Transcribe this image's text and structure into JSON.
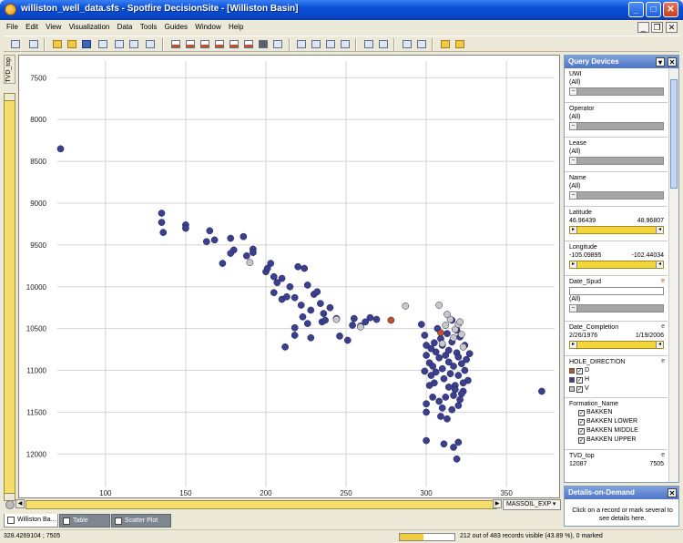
{
  "window": {
    "title": "williston_well_data.sfs - Spotfire DecisionSite - [Williston Basin]",
    "minimize": "_",
    "maximize": "□",
    "close": "✕"
  },
  "menu": [
    "File",
    "Edit",
    "View",
    "Visualization",
    "Data",
    "Tools",
    "Guides",
    "Window",
    "Help"
  ],
  "mdi": {
    "minimize": "_",
    "restore": "❐",
    "close": "✕"
  },
  "left_tab": {
    "label": "TVD_top"
  },
  "x_axis_column": "MASSOIL_EXP",
  "doc_tabs": [
    {
      "label": "Williston Ba..."
    },
    {
      "label": "Table"
    },
    {
      "label": "Scatter Plot"
    }
  ],
  "status": {
    "coords": "328.4269104 ; 7505",
    "visible": "212 out of 483 records visible (43.89 %), 0 marked",
    "visible_fraction": 0.4389
  },
  "query_panel": {
    "title": "Query Devices",
    "devices": {
      "uwi": {
        "name": "UWI",
        "value": "(All)"
      },
      "operator": {
        "name": "Operator",
        "value": "(All)"
      },
      "lease": {
        "name": "Lease",
        "value": "(All)"
      },
      "well_name": {
        "name": "Name",
        "value": "(All)"
      },
      "latitude": {
        "name": "Latitude",
        "min": "46.96439",
        "max": "48.96807"
      },
      "longitude": {
        "name": "Longitude",
        "min": "-105.09895",
        "max": "-102.44034"
      },
      "date_spud": {
        "name": "Date_Spud",
        "value": "(All)",
        "flag": "e"
      },
      "date_completion": {
        "name": "Date_Completion",
        "min": "2/26/1976",
        "max": "1/19/2006",
        "flag": "e"
      },
      "hole_direction": {
        "name": "HOLE_DIRECTION",
        "flag": "e",
        "options": [
          {
            "label": "D",
            "color": "#c0502a"
          },
          {
            "label": "H",
            "color": "#3a3f8f"
          },
          {
            "label": "V",
            "color": "#c8c8c8"
          }
        ]
      },
      "formation": {
        "name": "Formation_Name",
        "options": [
          "BAKKEN",
          "BAKKEN LOWER",
          "BAKKEN MIDDLE",
          "BAKKEN UPPER"
        ]
      },
      "tvd_top": {
        "name": "TVD_top",
        "min": "12087",
        "max": "7505",
        "flag": "e"
      }
    }
  },
  "details_panel": {
    "title": "Details-on-Demand",
    "message": "Click on a record or mark several to see details here."
  },
  "chart_data": {
    "type": "scatter",
    "xlim": [
      70,
      380
    ],
    "ylim": [
      7300,
      12400
    ],
    "y_inverted": true,
    "xticks": [
      100,
      150,
      200,
      250,
      300,
      350
    ],
    "yticks": [
      7500,
      8000,
      8500,
      9000,
      9500,
      10000,
      10500,
      11000,
      11500,
      12000
    ],
    "grid": true,
    "series": [
      {
        "color": "#3a3f8f",
        "points": [
          [
            72,
            8350
          ],
          [
            135,
            9120
          ],
          [
            135,
            9230
          ],
          [
            136,
            9350
          ],
          [
            150,
            9260
          ],
          [
            150,
            9300
          ],
          [
            163,
            9460
          ],
          [
            165,
            9330
          ],
          [
            168,
            9440
          ],
          [
            173,
            9720
          ],
          [
            178,
            9420
          ],
          [
            180,
            9560
          ],
          [
            178,
            9600
          ],
          [
            186,
            9400
          ],
          [
            188,
            9630
          ],
          [
            192,
            9550
          ],
          [
            192,
            9590
          ],
          [
            200,
            9820
          ],
          [
            201,
            9780
          ],
          [
            203,
            9720
          ],
          [
            205,
            9880
          ],
          [
            207,
            9950
          ],
          [
            210,
            9900
          ],
          [
            210,
            10150
          ],
          [
            205,
            10070
          ],
          [
            215,
            10000
          ],
          [
            213,
            10120
          ],
          [
            218,
            10130
          ],
          [
            220,
            9760
          ],
          [
            222,
            10220
          ],
          [
            224,
            9780
          ],
          [
            226,
            9980
          ],
          [
            228,
            10280
          ],
          [
            230,
            10090
          ],
          [
            232,
            10060
          ],
          [
            234,
            10200
          ],
          [
            235,
            10420
          ],
          [
            236,
            10320
          ],
          [
            237,
            10400
          ],
          [
            240,
            10250
          ],
          [
            244,
            10380
          ],
          [
            246,
            10590
          ],
          [
            251,
            10640
          ],
          [
            255,
            10380
          ],
          [
            259,
            10470
          ],
          [
            262,
            10420
          ],
          [
            265,
            10370
          ],
          [
            269,
            10390
          ],
          [
            226,
            10440
          ],
          [
            218,
            10490
          ],
          [
            218,
            10580
          ],
          [
            228,
            10610
          ],
          [
            223,
            10360
          ],
          [
            212,
            10720
          ],
          [
            254,
            10460
          ],
          [
            297,
            10450
          ],
          [
            299,
            10580
          ],
          [
            300,
            10700
          ],
          [
            300,
            10820
          ],
          [
            302,
            10910
          ],
          [
            304,
            10950
          ],
          [
            305,
            10670
          ],
          [
            306,
            10780
          ],
          [
            306,
            11020
          ],
          [
            308,
            10850
          ],
          [
            309,
            10620
          ],
          [
            310,
            10700
          ],
          [
            310,
            10980
          ],
          [
            311,
            11100
          ],
          [
            312,
            10820
          ],
          [
            313,
            10560
          ],
          [
            314,
            10760
          ],
          [
            314,
            10900
          ],
          [
            315,
            11040
          ],
          [
            316,
            10660
          ],
          [
            317,
            10950
          ],
          [
            318,
            11180
          ],
          [
            319,
            10790
          ],
          [
            320,
            10840
          ],
          [
            320,
            11060
          ],
          [
            321,
            10600
          ],
          [
            322,
            10920
          ],
          [
            323,
            11250
          ],
          [
            324,
            10700
          ],
          [
            324,
            11000
          ],
          [
            325,
            10870
          ],
          [
            326,
            11120
          ],
          [
            302,
            11180
          ],
          [
            304,
            11320
          ],
          [
            308,
            11370
          ],
          [
            310,
            11450
          ],
          [
            312,
            11320
          ],
          [
            316,
            11470
          ],
          [
            318,
            11230
          ],
          [
            320,
            11420
          ],
          [
            322,
            11280
          ],
          [
            300,
            11400
          ],
          [
            300,
            11500
          ],
          [
            309,
            11550
          ],
          [
            313,
            11580
          ],
          [
            300,
            11840
          ],
          [
            311,
            11880
          ],
          [
            317,
            11920
          ],
          [
            319,
            12060
          ],
          [
            320,
            11860
          ],
          [
            372,
            11250
          ],
          [
            303,
            10740
          ],
          [
            307,
            10500
          ],
          [
            316,
            10400
          ],
          [
            319,
            10520
          ],
          [
            314,
            11200
          ],
          [
            321,
            11350
          ],
          [
            305,
            11150
          ],
          [
            317,
            11300
          ],
          [
            323,
            11150
          ],
          [
            299,
            11010
          ],
          [
            303,
            11060
          ],
          [
            327,
            10800
          ]
        ]
      },
      {
        "color": "#c8c8c8",
        "points": [
          [
            190,
            9710
          ],
          [
            244,
            10390
          ],
          [
            259,
            10480
          ],
          [
            287,
            10230
          ],
          [
            308,
            10220
          ],
          [
            312,
            10460
          ],
          [
            315,
            10390
          ],
          [
            318,
            10510
          ],
          [
            320,
            10450
          ],
          [
            321,
            10420
          ],
          [
            313,
            10330
          ],
          [
            322,
            10570
          ],
          [
            310,
            10680
          ],
          [
            317,
            10610
          ],
          [
            323,
            10720
          ]
        ]
      },
      {
        "color": "#c0502a",
        "points": [
          [
            278,
            10400
          ],
          [
            309,
            10550
          ]
        ]
      }
    ]
  }
}
